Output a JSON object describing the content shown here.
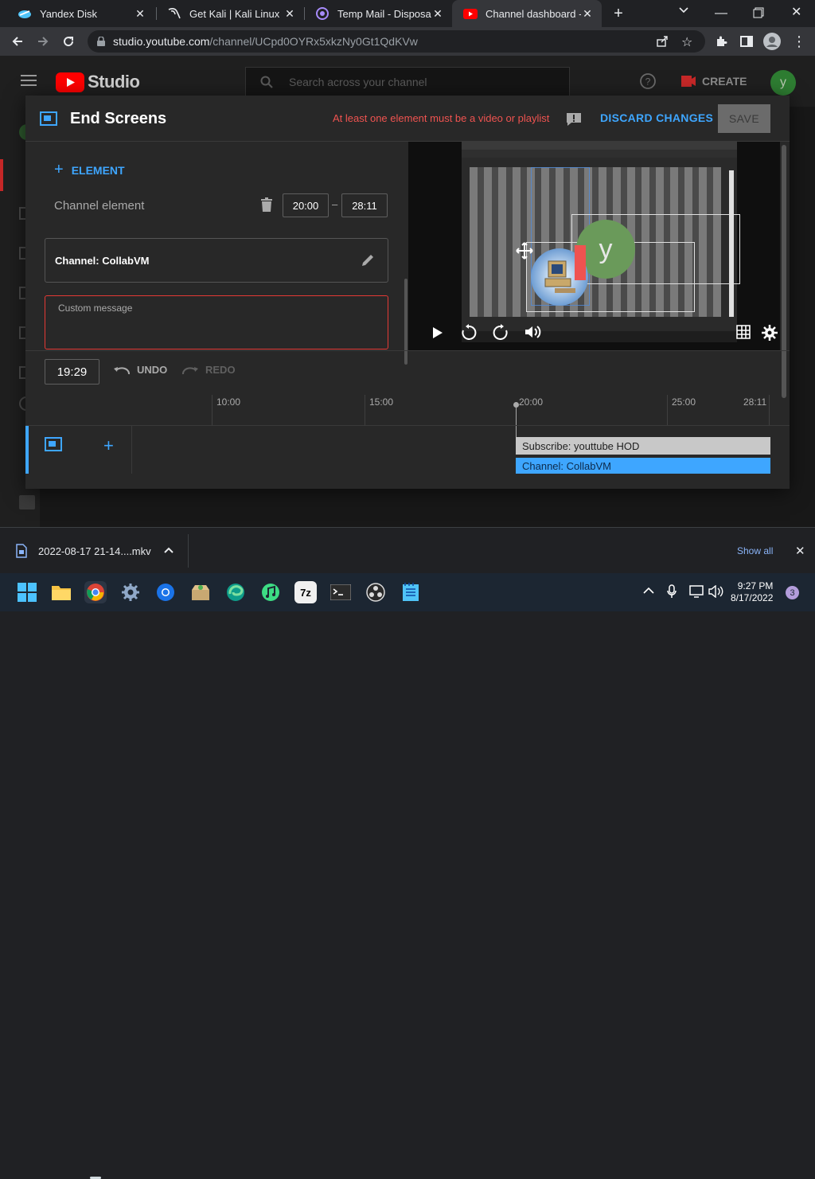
{
  "browser": {
    "tabs": [
      {
        "title": "Yandex Disk",
        "active": false
      },
      {
        "title": "Get Kali | Kali Linux",
        "active": false
      },
      {
        "title": "Temp Mail - Disposable",
        "active": false
      },
      {
        "title": "Channel dashboard - YouTube",
        "active": true
      }
    ],
    "url_host": "studio.youtube.com",
    "url_path": "/channel/UCpd0OYRx5xkzNy0Gt1QdKVw"
  },
  "studio": {
    "logo": "Studio",
    "search_placeholder": "Search across your channel",
    "create_label": "CREATE",
    "avatar_letter": "y"
  },
  "modal": {
    "title": "End Screens",
    "warning": "At least one element must be a video or playlist",
    "discard_label": "DISCARD CHANGES",
    "save_label": "SAVE",
    "add_element_label": "ELEMENT",
    "channel_element_label": "Channel element",
    "start_time": "20:00",
    "end_time": "28:11",
    "channel_label": "Channel: CollabVM",
    "custom_message_placeholder": "Custom message",
    "preview_avatar_letter": "y"
  },
  "timeline": {
    "current_time": "19:29",
    "undo_label": "UNDO",
    "redo_label": "REDO",
    "ticks": [
      "10:00",
      "15:00",
      "20:00",
      "25:00",
      "28:11"
    ],
    "elements": [
      {
        "label": "Subscribe: youttube HOD"
      },
      {
        "label": "Channel: CollabVM"
      }
    ]
  },
  "downloads": {
    "file_name": "2022-08-17 21-14....mkv",
    "show_all_label": "Show all"
  },
  "taskbar": {
    "time": "9:27 PM",
    "date": "8/17/2022",
    "notification_count": "3",
    "app_7z_label": "7z"
  },
  "colors": {
    "accent": "#3ea6ff",
    "warning": "#ef5350",
    "youtube_red": "#ff0000"
  }
}
